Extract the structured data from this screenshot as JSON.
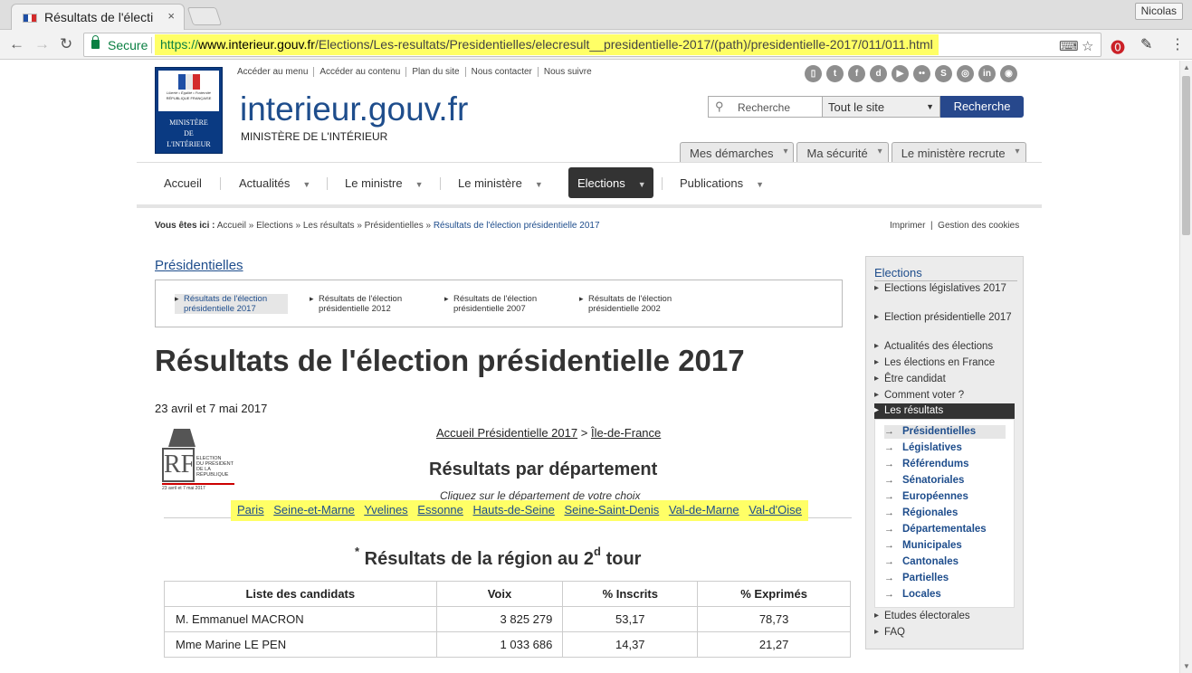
{
  "browser": {
    "tab_title": "Résultats de l'électi",
    "tab_close": "×",
    "user": "Nicolas",
    "secure_label": "Secure",
    "url_scheme": "https://",
    "url_host": "www.interieur.gouv.fr",
    "url_path": "/Elections/Les-resultats/Presidentielles/elecresult__presidentielle-2017/(path)/presidentielle-2017/011/011.html",
    "icons": [
      "back-arrow-icon",
      "forward-arrow-icon",
      "reload-icon",
      "lock-icon",
      "translate-icon",
      "star-icon",
      "pinterest-icon",
      "eyedropper-icon",
      "menu-dots-icon"
    ]
  },
  "header": {
    "logo": {
      "devise": "Liberté • Égalité • Fraternité",
      "republique": "RÉPUBLIQUE FRANÇAISE",
      "ministere_lines": [
        "MINISTÈRE",
        "DE",
        "L'INTÉRIEUR"
      ]
    },
    "site_title": "interieur.gouv.fr",
    "site_subtitle": "MINISTÈRE DE L'INTÉRIEUR",
    "top_links": [
      "Accéder au menu",
      "Accéder au contenu",
      "Plan du site",
      "Nous contacter",
      "Nous suivre"
    ],
    "social_icons": [
      "mobile-icon",
      "twitter-icon",
      "facebook-icon",
      "dailymotion-icon",
      "youtube-icon",
      "flickr-icon",
      "storify-icon",
      "instagram-icon",
      "linkedin-icon",
      "rss-icon"
    ],
    "search": {
      "placeholder": "Recherche",
      "scope": "Tout le site",
      "button": "Recherche"
    },
    "tabs": [
      "Mes démarches",
      "Ma sécurité",
      "Le ministère recrute"
    ]
  },
  "nav": {
    "items": [
      "Accueil",
      "Actualités",
      "Le ministre",
      "Le ministère",
      "Elections",
      "Publications"
    ],
    "active": "Elections"
  },
  "breadcrumb": {
    "prefix": "Vous êtes ici :",
    "items": [
      "Accueil",
      "Elections",
      "Les résultats",
      "Présidentielles"
    ],
    "current": "Résultats de l'élection présidentielle 2017",
    "separator": "»",
    "right_links": [
      "Imprimer",
      "Gestion des cookies"
    ]
  },
  "main": {
    "section_link": "Présidentielles",
    "subnav": [
      "Résultats de l'élection présidentielle 2017",
      "Résultats de l'élection présidentielle 2012",
      "Résultats de l'élection présidentielle 2007",
      "Résultats de l'élection présidentielle 2002"
    ],
    "title": "Résultats de l'élection présidentielle 2017",
    "date": "23 avril et 7 mai 2017",
    "election_logo": {
      "letters": "RF",
      "text_lines": [
        "ELECTION",
        "DU PRÉSIDENT",
        "DE LA",
        "RÉPUBLIQUE"
      ],
      "date": "23 avril et 7 mai 2017"
    },
    "accueil_link": "Accueil Présidentielle 2017",
    "accueil_sep": ">",
    "region_link": "Île-de-France",
    "results_heading": "Résultats par département",
    "instruction": "Cliquez sur le département de votre choix",
    "departments": [
      "Paris",
      "Seine-et-Marne",
      "Yvelines",
      "Essonne",
      "Hauts-de-Seine",
      "Seine-Saint-Denis",
      "Val-de-Marne",
      "Val-d'Oise"
    ],
    "region_title": {
      "star": "*",
      "before": "Résultats de la région au 2",
      "sup": "d",
      "after": "tour"
    },
    "table": {
      "headers": [
        "Liste des candidats",
        "Voix",
        "% Inscrits",
        "% Exprimés"
      ],
      "rows": [
        [
          "M. Emmanuel MACRON",
          "3 825 279",
          "53,17",
          "78,73"
        ],
        [
          "Mme Marine LE PEN",
          "1 033 686",
          "14,37",
          "21,27"
        ]
      ]
    }
  },
  "sidebar": {
    "title": "Elections",
    "items": [
      "Elections législatives 2017",
      "Election présidentielle 2017",
      "Actualités des élections",
      "Les élections en France",
      "Être candidat",
      "Comment voter ?",
      "Les résultats"
    ],
    "active": "Les résultats",
    "subitems": [
      "Présidentielles",
      "Législatives",
      "Référendums",
      "Sénatoriales",
      "Européennes",
      "Régionales",
      "Départementales",
      "Municipales",
      "Cantonales",
      "Partielles",
      "Locales"
    ],
    "footer_items": [
      "Etudes électorales",
      "FAQ"
    ]
  },
  "colors": {
    "brand_blue": "#1e4d8c",
    "search_button": "#27488c",
    "nav_active": "#333333",
    "highlight": "#ffff66",
    "secure_green": "#0b8043"
  }
}
